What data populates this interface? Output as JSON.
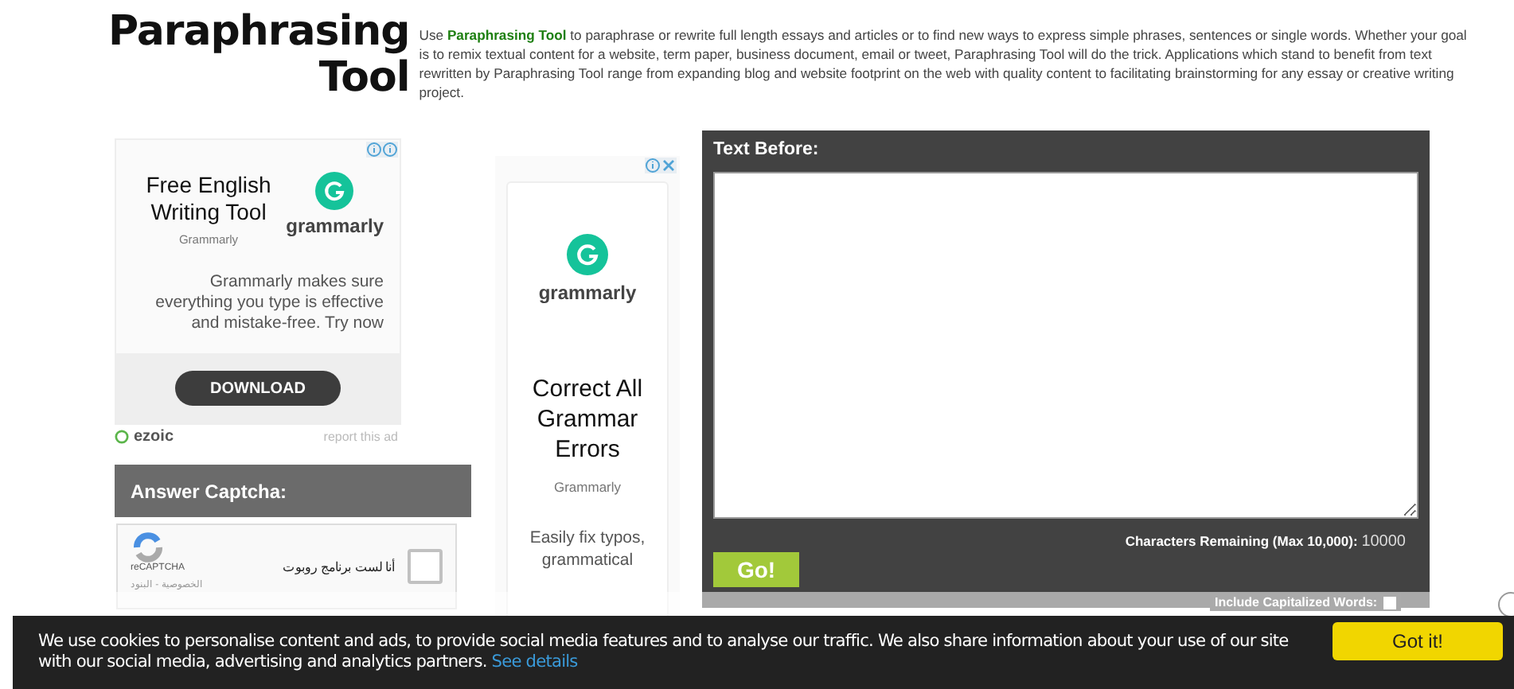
{
  "header": {
    "title_lines": [
      "Paraphrasing",
      "Tool"
    ],
    "intro": "Use **Paraphrasing Tool** to paraphrase or rewrite full length essays and articles or to find new ways to express simple phrases, sentences or single words. Whether your goal is to remix textual content for a website, term paper, business document, email or tweet, Paraphrasing Tool will do the trick. Applications which stand to benefit from text rewritten by Paraphrasing Tool range from expanding blog and website footprint on the web with quality content to facilitating brainstorming for any essay or creative writing project."
  },
  "left_ad": {
    "headline": "Free English Writing Tool",
    "advertiser": "Grammarly",
    "brand": "grammarly",
    "body": "Grammarly makes sure everything you type is effective and mistake-free. Try now",
    "cta": "DOWNLOAD",
    "network": "ezoic",
    "report": "report this ad"
  },
  "captcha": {
    "heading": "Answer Captcha:",
    "checkbox_label": "أنا لست برنامج روبوت",
    "checked": false,
    "logo_text": "reCAPTCHA",
    "links": "الخصوصية - البنود"
  },
  "middle_ad": {
    "brand": "grammarly",
    "headline": "Correct All Grammar Errors",
    "advertiser": "Grammarly",
    "body": "Easily fix typos, grammatical"
  },
  "editor": {
    "heading": "Text Before:",
    "remaining_label": "Characters Remaining (Max 10,000):",
    "remaining_value": "10000",
    "go": "Go!",
    "capitalized_label": "Include Capitalized Words:",
    "capitalized": false
  },
  "cookie_banner": {
    "text": "We use cookies to personalise content and ads, to provide social media features and to analyse our traffic. We also share information about your use of our site with our social media, advertising and analytics partners.",
    "link": "See details",
    "button": "Got it!"
  }
}
